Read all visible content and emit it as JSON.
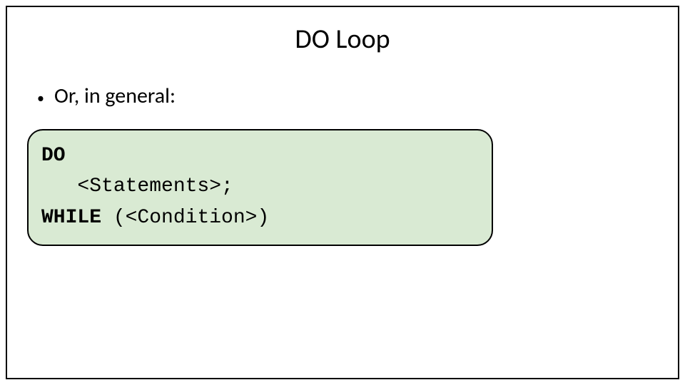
{
  "title": "DO Loop",
  "bullet": {
    "text": "Or, in general:"
  },
  "code": {
    "line1_pre": "DO",
    "line2": "   <Statements>;",
    "line3_pre": "WHILE",
    "line3_rest": " (<Condition>)"
  }
}
